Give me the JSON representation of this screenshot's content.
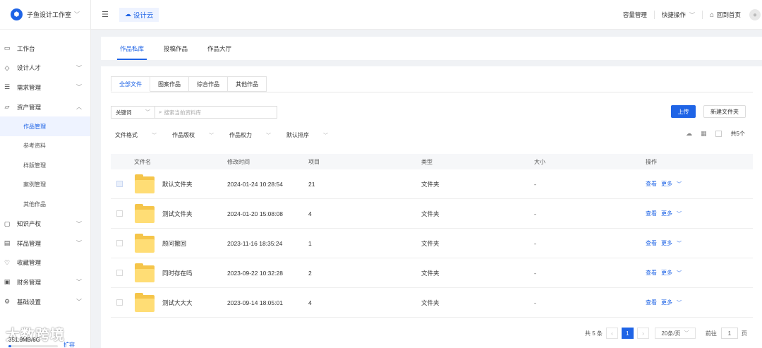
{
  "brand": {
    "name": "子鱼设计工作室",
    "logo_icon": "cube-icon"
  },
  "sidebar": {
    "items": [
      {
        "label": "工作台",
        "icon": "monitor-icon",
        "has_caret": false
      },
      {
        "label": "设计人才",
        "icon": "graduation-cap-icon",
        "has_caret": true
      },
      {
        "label": "需求管理",
        "icon": "edit-list-icon",
        "has_caret": true
      },
      {
        "label": "资产管理",
        "icon": "folder-icon",
        "has_caret": true,
        "expanded": true
      }
    ],
    "sub_items": [
      {
        "label": "作品管理",
        "active": true
      },
      {
        "label": "参考资料",
        "active": false
      },
      {
        "label": "样版管理",
        "active": false
      },
      {
        "label": "案例管理",
        "active": false
      },
      {
        "label": "其他作品",
        "active": false
      }
    ],
    "items_after": [
      {
        "label": "知识产权",
        "icon": "copyright-icon",
        "has_caret": true
      },
      {
        "label": "样品管理",
        "icon": "box-icon",
        "has_caret": true
      },
      {
        "label": "收藏管理",
        "icon": "heart-icon",
        "has_caret": false
      },
      {
        "label": "财务管理",
        "icon": "wallet-icon",
        "has_caret": true
      },
      {
        "label": "基础设置",
        "icon": "gear-icon",
        "has_caret": true
      }
    ],
    "storage": {
      "used_text": "351.9MB/6G",
      "expand_label": "扩容",
      "used_fraction": 0.06
    },
    "watermark": "大数跨境"
  },
  "topbar": {
    "cloud_tab": "设计云",
    "capacity": "容量管理",
    "quick_ops": "快捷操作",
    "home": "回到首页"
  },
  "main_tabs": [
    {
      "label": "作品私库",
      "active": true
    },
    {
      "label": "投稿作品",
      "active": false
    },
    {
      "label": "作品大厅",
      "active": false
    }
  ],
  "sub_tabs": [
    {
      "label": "全部文件",
      "active": true
    },
    {
      "label": "图案作品",
      "active": false
    },
    {
      "label": "综合作品",
      "active": false
    },
    {
      "label": "其他作品",
      "active": false
    }
  ],
  "search": {
    "keyword_select": "关键词",
    "placeholder": "搜索当前资料库"
  },
  "buttons": {
    "upload": "上传",
    "new_folder": "新建文件夹"
  },
  "filters": [
    "文件格式",
    "作品版权",
    "作品权力",
    "默认排序"
  ],
  "count_text": "共5个",
  "table": {
    "headers": {
      "name": "文件名",
      "time": "修改时间",
      "count": "项目",
      "type": "类型",
      "size": "大小",
      "ops": "操作"
    },
    "rows": [
      {
        "name": "默认文件夹",
        "time": "2024-01-24 10:28:54",
        "count": "21",
        "type": "文件夹",
        "size": "-",
        "view": "查看",
        "more": "更多",
        "selected": true
      },
      {
        "name": "测试文件夹",
        "time": "2024-01-20 15:08:08",
        "count": "4",
        "type": "文件夹",
        "size": "-",
        "view": "查看",
        "more": "更多",
        "selected": false
      },
      {
        "name": "顾问撤回",
        "time": "2023-11-16 18:35:24",
        "count": "1",
        "type": "文件夹",
        "size": "-",
        "view": "查看",
        "more": "更多",
        "selected": false
      },
      {
        "name": "同时存在吗",
        "time": "2023-09-22 10:32:28",
        "count": "2",
        "type": "文件夹",
        "size": "-",
        "view": "查看",
        "more": "更多",
        "selected": false
      },
      {
        "name": "测试大大大",
        "time": "2023-09-14 18:05:01",
        "count": "4",
        "type": "文件夹",
        "size": "-",
        "view": "查看",
        "more": "更多",
        "selected": false
      }
    ]
  },
  "pagination": {
    "total": "共 5 条",
    "current_page": "1",
    "page_size": "20条/页",
    "goto_label": "前往",
    "goto_value": "1",
    "page_unit": "页"
  },
  "colors": {
    "accent": "#1f64e6",
    "folder": "#ffdd75"
  }
}
